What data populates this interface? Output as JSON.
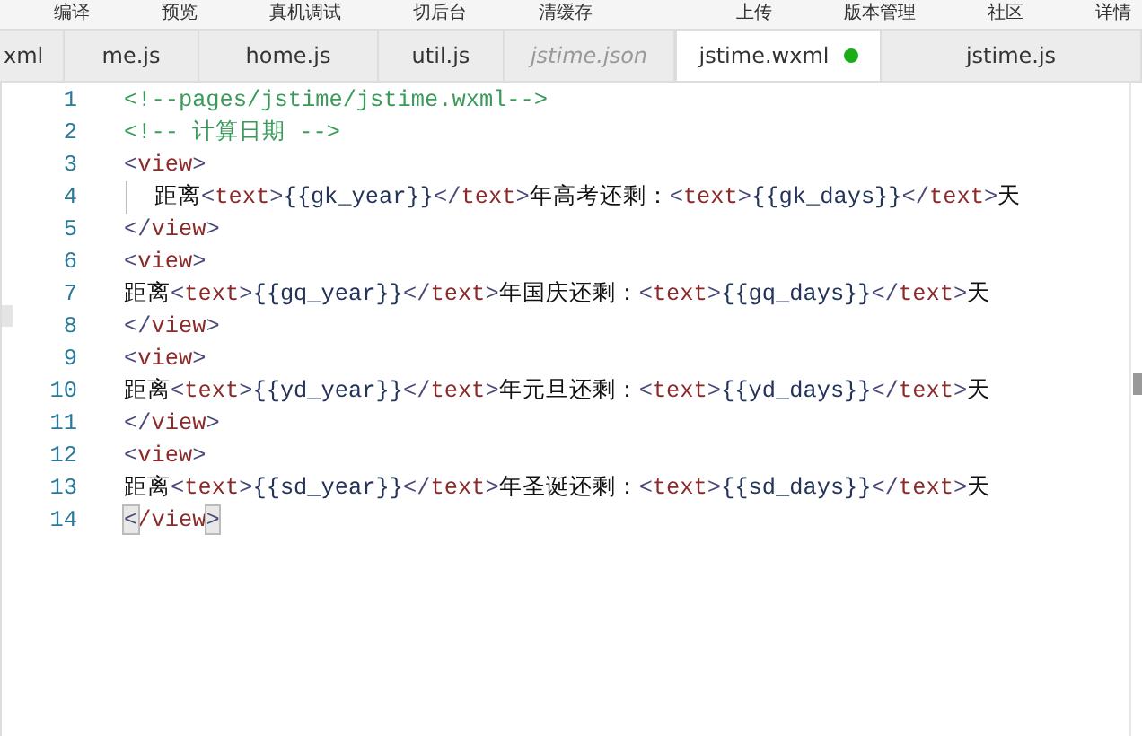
{
  "toolbar": {
    "items": [
      {
        "label": "编译"
      },
      {
        "label": "预览"
      },
      {
        "label": "真机调试"
      },
      {
        "label": "切后台"
      },
      {
        "label": "清缓存"
      }
    ],
    "right_items": [
      {
        "label": "上传"
      },
      {
        "label": "版本管理"
      },
      {
        "label": "社区"
      },
      {
        "label": "详情"
      }
    ]
  },
  "tabs": [
    {
      "label": "xml",
      "selected": false,
      "italic": false,
      "modified": false
    },
    {
      "label": "me.js",
      "selected": false,
      "italic": false,
      "modified": false
    },
    {
      "label": "home.js",
      "selected": false,
      "italic": false,
      "modified": false
    },
    {
      "label": "util.js",
      "selected": false,
      "italic": false,
      "modified": false
    },
    {
      "label": "jstime.json",
      "selected": false,
      "italic": true,
      "modified": false
    },
    {
      "label": "jstime.wxml",
      "selected": true,
      "italic": false,
      "modified": true
    },
    {
      "label": "jstime.js",
      "selected": false,
      "italic": false,
      "modified": false
    }
  ],
  "editor": {
    "lines": [
      {
        "number": "1",
        "indented": false,
        "segments": [
          {
            "kind": "comment",
            "text": "<!--pages/jstime/jstime.wxml-->"
          }
        ]
      },
      {
        "number": "2",
        "indented": false,
        "segments": [
          {
            "kind": "comment",
            "text": "<!-- 计算日期 -->"
          }
        ]
      },
      {
        "number": "3",
        "indented": false,
        "segments": [
          {
            "kind": "punct",
            "text": "<"
          },
          {
            "kind": "tag",
            "text": "view"
          },
          {
            "kind": "punct",
            "text": ">"
          }
        ]
      },
      {
        "number": "4",
        "indented": true,
        "segments": [
          {
            "kind": "plain",
            "text": "距离"
          },
          {
            "kind": "punct",
            "text": "<"
          },
          {
            "kind": "tag",
            "text": "text"
          },
          {
            "kind": "punct",
            "text": ">"
          },
          {
            "kind": "expr",
            "text": "{{gk_year}}"
          },
          {
            "kind": "punct",
            "text": "</"
          },
          {
            "kind": "tag",
            "text": "text"
          },
          {
            "kind": "punct",
            "text": ">"
          },
          {
            "kind": "plain",
            "text": "年高考还剩："
          },
          {
            "kind": "punct",
            "text": "<"
          },
          {
            "kind": "tag",
            "text": "text"
          },
          {
            "kind": "punct",
            "text": ">"
          },
          {
            "kind": "expr",
            "text": "{{gk_days}}"
          },
          {
            "kind": "punct",
            "text": "</"
          },
          {
            "kind": "tag",
            "text": "text"
          },
          {
            "kind": "punct",
            "text": ">"
          },
          {
            "kind": "plain",
            "text": "天"
          }
        ]
      },
      {
        "number": "5",
        "indented": false,
        "segments": [
          {
            "kind": "punct",
            "text": "</"
          },
          {
            "kind": "tag",
            "text": "view"
          },
          {
            "kind": "punct",
            "text": ">"
          }
        ]
      },
      {
        "number": "6",
        "indented": false,
        "segments": [
          {
            "kind": "punct",
            "text": "<"
          },
          {
            "kind": "tag",
            "text": "view"
          },
          {
            "kind": "punct",
            "text": ">"
          }
        ]
      },
      {
        "number": "7",
        "indented": false,
        "segments": [
          {
            "kind": "plain",
            "text": "距离"
          },
          {
            "kind": "punct",
            "text": "<"
          },
          {
            "kind": "tag",
            "text": "text"
          },
          {
            "kind": "punct",
            "text": ">"
          },
          {
            "kind": "expr",
            "text": "{{gq_year}}"
          },
          {
            "kind": "punct",
            "text": "</"
          },
          {
            "kind": "tag",
            "text": "text"
          },
          {
            "kind": "punct",
            "text": ">"
          },
          {
            "kind": "plain",
            "text": "年国庆还剩："
          },
          {
            "kind": "punct",
            "text": "<"
          },
          {
            "kind": "tag",
            "text": "text"
          },
          {
            "kind": "punct",
            "text": ">"
          },
          {
            "kind": "expr",
            "text": "{{gq_days}}"
          },
          {
            "kind": "punct",
            "text": "</"
          },
          {
            "kind": "tag",
            "text": "text"
          },
          {
            "kind": "punct",
            "text": ">"
          },
          {
            "kind": "plain",
            "text": "天"
          }
        ]
      },
      {
        "number": "8",
        "indented": false,
        "segments": [
          {
            "kind": "punct",
            "text": "</"
          },
          {
            "kind": "tag",
            "text": "view"
          },
          {
            "kind": "punct",
            "text": ">"
          }
        ]
      },
      {
        "number": "9",
        "indented": false,
        "segments": [
          {
            "kind": "punct",
            "text": "<"
          },
          {
            "kind": "tag",
            "text": "view"
          },
          {
            "kind": "punct",
            "text": ">"
          }
        ]
      },
      {
        "number": "10",
        "indented": false,
        "segments": [
          {
            "kind": "plain",
            "text": "距离"
          },
          {
            "kind": "punct",
            "text": "<"
          },
          {
            "kind": "tag",
            "text": "text"
          },
          {
            "kind": "punct",
            "text": ">"
          },
          {
            "kind": "expr",
            "text": "{{yd_year}}"
          },
          {
            "kind": "punct",
            "text": "</"
          },
          {
            "kind": "tag",
            "text": "text"
          },
          {
            "kind": "punct",
            "text": ">"
          },
          {
            "kind": "plain",
            "text": "年元旦还剩："
          },
          {
            "kind": "punct",
            "text": "<"
          },
          {
            "kind": "tag",
            "text": "text"
          },
          {
            "kind": "punct",
            "text": ">"
          },
          {
            "kind": "expr",
            "text": "{{yd_days}}"
          },
          {
            "kind": "punct",
            "text": "</"
          },
          {
            "kind": "tag",
            "text": "text"
          },
          {
            "kind": "punct",
            "text": ">"
          },
          {
            "kind": "plain",
            "text": "天"
          }
        ]
      },
      {
        "number": "11",
        "indented": false,
        "segments": [
          {
            "kind": "punct",
            "text": "</"
          },
          {
            "kind": "tag",
            "text": "view"
          },
          {
            "kind": "punct",
            "text": ">"
          }
        ]
      },
      {
        "number": "12",
        "indented": false,
        "segments": [
          {
            "kind": "punct",
            "text": "<"
          },
          {
            "kind": "tag",
            "text": "view"
          },
          {
            "kind": "punct",
            "text": ">"
          }
        ]
      },
      {
        "number": "13",
        "indented": false,
        "segments": [
          {
            "kind": "plain",
            "text": "距离"
          },
          {
            "kind": "punct",
            "text": "<"
          },
          {
            "kind": "tag",
            "text": "text"
          },
          {
            "kind": "punct",
            "text": ">"
          },
          {
            "kind": "expr",
            "text": "{{sd_year}}"
          },
          {
            "kind": "punct",
            "text": "</"
          },
          {
            "kind": "tag",
            "text": "text"
          },
          {
            "kind": "punct",
            "text": ">"
          },
          {
            "kind": "plain",
            "text": "年圣诞还剩："
          },
          {
            "kind": "punct",
            "text": "<"
          },
          {
            "kind": "tag",
            "text": "text"
          },
          {
            "kind": "punct",
            "text": ">"
          },
          {
            "kind": "expr",
            "text": "{{sd_days}}"
          },
          {
            "kind": "punct",
            "text": "</"
          },
          {
            "kind": "tag",
            "text": "text"
          },
          {
            "kind": "punct",
            "text": ">"
          },
          {
            "kind": "plain",
            "text": "天"
          }
        ]
      },
      {
        "number": "14",
        "indented": false,
        "segments": [
          {
            "kind": "match",
            "text": "<"
          },
          {
            "kind": "tag",
            "text": "/view"
          },
          {
            "kind": "match",
            "text": ">"
          }
        ]
      }
    ]
  }
}
